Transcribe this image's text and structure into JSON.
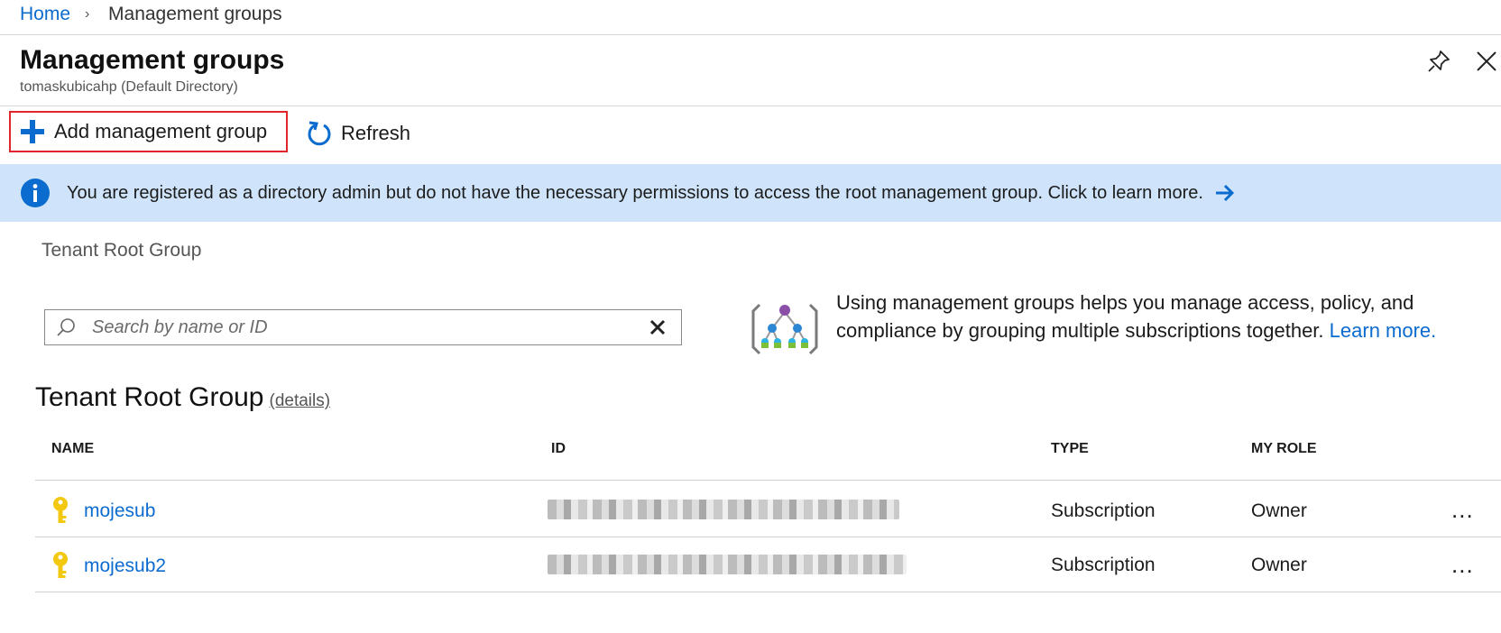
{
  "breadcrumb": {
    "home": "Home",
    "separator": "›",
    "current": "Management groups"
  },
  "header": {
    "title": "Management groups",
    "subtitle": "tomaskubicahp (Default Directory)"
  },
  "toolbar": {
    "add_label": "Add management group",
    "refresh_label": "Refresh"
  },
  "banner": {
    "message": "You are registered as a directory admin but do not have the necessary permissions to access the root management group. Click to learn more."
  },
  "scope_label": "Tenant Root Group",
  "search": {
    "placeholder": "Search by name or ID"
  },
  "help": {
    "text": "Using management groups helps you manage access, policy, and compliance by grouping multiple subscriptions together.",
    "link": "Learn more."
  },
  "group": {
    "title": "Tenant Root Group",
    "details": "(details)"
  },
  "table": {
    "columns": [
      "NAME",
      "ID",
      "TYPE",
      "MY ROLE"
    ],
    "rows": [
      {
        "name": "mojesub",
        "type": "Subscription",
        "role": "Owner",
        "more": "..."
      },
      {
        "name": "mojesub2",
        "type": "Subscription",
        "role": "Owner",
        "more": "..."
      }
    ]
  },
  "colors": {
    "accent": "#0b6bcf",
    "banner_bg": "#cfe4fa",
    "highlight_border": "#e0262b",
    "key_icon": "#f2c811"
  },
  "icons": [
    "chevron-right-icon",
    "pin-icon",
    "close-icon",
    "plus-icon",
    "refresh-icon",
    "info-icon",
    "arrow-right-icon",
    "search-icon",
    "clear-icon",
    "management-group-icon",
    "key-icon",
    "more-icon"
  ]
}
